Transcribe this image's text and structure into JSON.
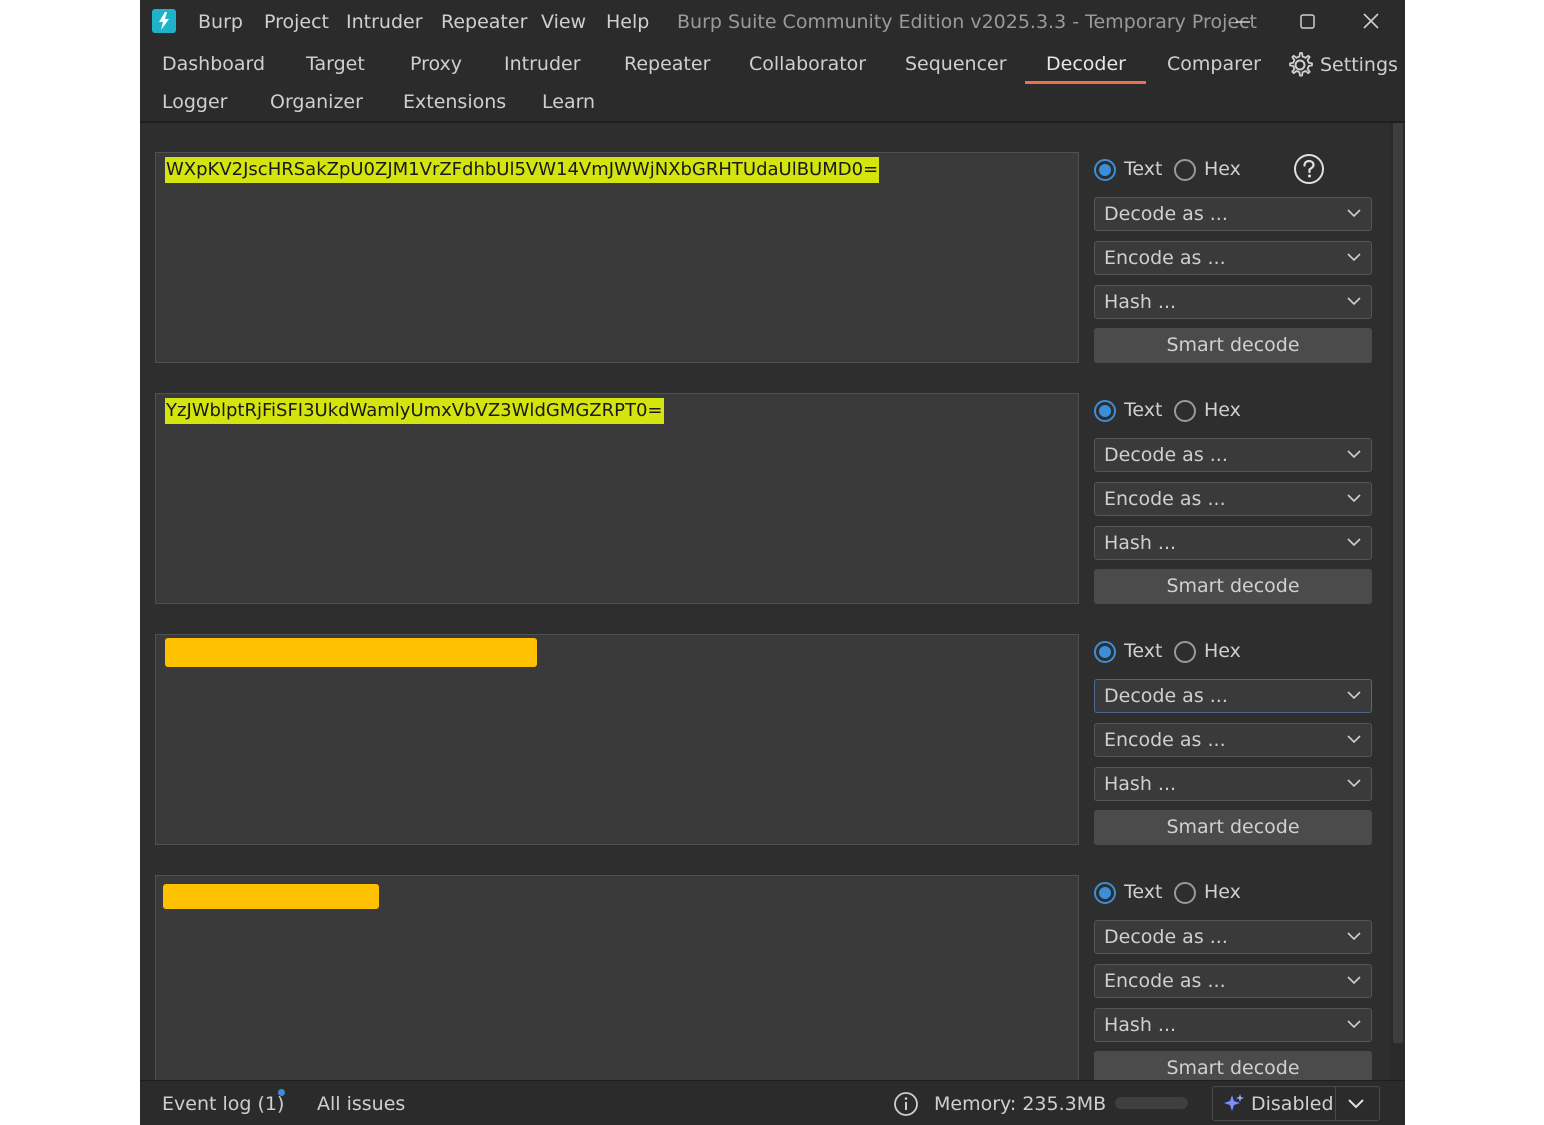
{
  "menu": [
    "Burp",
    "Project",
    "Intruder",
    "Repeater",
    "View",
    "Help"
  ],
  "window_title": "Burp Suite Community Edition v2025.3.3 - Temporary Project",
  "tabs_row1": [
    "Dashboard",
    "Target",
    "Proxy",
    "Intruder",
    "Repeater",
    "Collaborator",
    "Sequencer",
    "Decoder",
    "Comparer"
  ],
  "settings_label": "Settings",
  "tabs_row2": [
    "Logger",
    "Organizer",
    "Extensions",
    "Learn"
  ],
  "active_tab": "Decoder",
  "panels": [
    {
      "content": "WXpKV2JscHRSakZpU0ZJM1VrZFdhbUl5VW14VmJWWjNXbGRHTUdaUlBUMD0=",
      "redacted": false
    },
    {
      "content": "YzJWblptRjFiSFI3UkdWamlyUmxVbVZ3WldGMGZRPT0=",
      "redacted": false
    },
    {
      "content": "",
      "redacted": true
    },
    {
      "content": "",
      "redacted": true
    }
  ],
  "controls": {
    "text_label": "Text",
    "hex_label": "Hex",
    "decode_label": "Decode as ...",
    "encode_label": "Encode as ...",
    "hash_label": "Hash ...",
    "smart_decode_label": "Smart decode"
  },
  "status": {
    "event_log": "Event log (1)",
    "all_issues": "All issues",
    "memory": "Memory: 235.3MB",
    "ai_state": "Disabled"
  },
  "colors": {
    "accent": "#e8724a",
    "radio": "#3a8fd8",
    "highlight": "#d4e40e",
    "redaction": "#ffc000"
  }
}
